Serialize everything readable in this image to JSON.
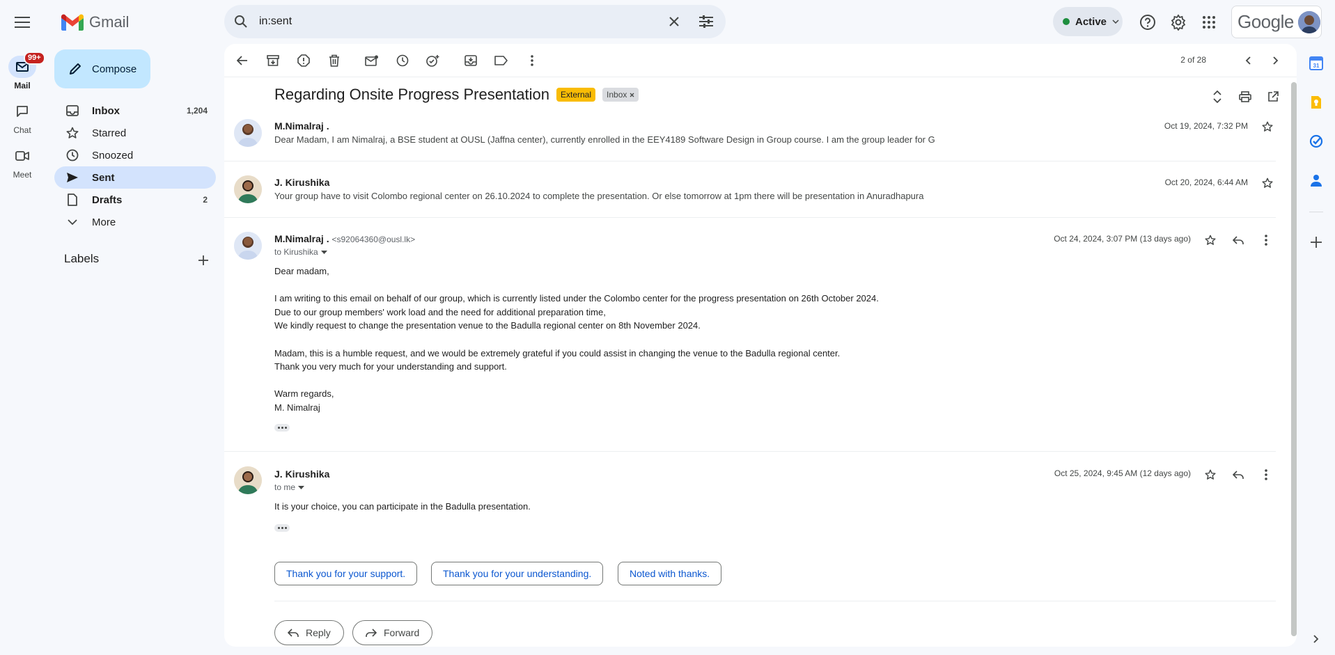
{
  "app": {
    "name": "Gmail",
    "brand_color": "#ea4335"
  },
  "search": {
    "value": "in:sent",
    "clear_icon": "close-icon",
    "options_icon": "tune-icon"
  },
  "header": {
    "status": "Active",
    "account_brand": "Google"
  },
  "rail": {
    "mail": {
      "label": "Mail",
      "badge": "99+"
    },
    "chat": {
      "label": "Chat"
    },
    "meet": {
      "label": "Meet"
    }
  },
  "nav": {
    "compose": "Compose",
    "items": [
      {
        "label": "Inbox",
        "count": "1,204",
        "bold": true
      },
      {
        "label": "Starred",
        "count": ""
      },
      {
        "label": "Snoozed",
        "count": ""
      },
      {
        "label": "Sent",
        "count": "",
        "selected": true
      },
      {
        "label": "Drafts",
        "count": "2",
        "bold": true
      },
      {
        "label": "More",
        "count": ""
      }
    ],
    "labels_title": "Labels"
  },
  "toolbar": {
    "pager": "2 of 28"
  },
  "thread": {
    "subject": "Regarding Onsite Progress Presentation",
    "chips": {
      "external": "External",
      "inbox": "Inbox"
    },
    "messages": [
      {
        "sender": "M.Nimalraj .",
        "snippet": "Dear Madam, I am Nimalraj, a BSE student at OUSL (Jaffna center), currently enrolled in the EEY4189 Software Design in Group course. I am the group leader for G",
        "date": "Oct 19, 2024, 7:32 PM"
      },
      {
        "sender": "J. Kirushika",
        "snippet": "Your group have to visit Colombo regional center on 26.10.2024 to complete the presentation. Or else tomorrow at 1pm there will be presentation in Anuradhapura",
        "date": "Oct 20, 2024, 6:44 AM"
      },
      {
        "sender": "M.Nimalraj .",
        "email": "<s92064360@ousl.lk>",
        "to": "to Kirushika",
        "date": "Oct 24, 2024, 3:07 PM (13 days ago)",
        "body": [
          "Dear madam,",
          "",
          "I am writing to this email on behalf of our group, which is currently listed under the Colombo center for the progress presentation on 26th October 2024.",
          "Due to our group members' work load and the need for additional preparation time,",
          "We kindly request to change the presentation venue to the Badulla regional center on 8th November 2024.",
          "",
          "Madam, this is a humble request, and we would be extremely grateful if you could assist in changing the venue to the Badulla regional center.",
          "Thank you very much for your understanding and support.",
          "",
          "Warm regards,",
          "M. Nimalraj"
        ]
      },
      {
        "sender": "J. Kirushika",
        "to": "to me",
        "date": "Oct 25, 2024, 9:45 AM (12 days ago)",
        "body": [
          "It is your choice, you can participate in the Badulla presentation."
        ]
      }
    ],
    "smart_replies": [
      "Thank you for your support.",
      "Thank you for your understanding.",
      "Noted with thanks."
    ],
    "reply": "Reply",
    "forward": "Forward"
  }
}
